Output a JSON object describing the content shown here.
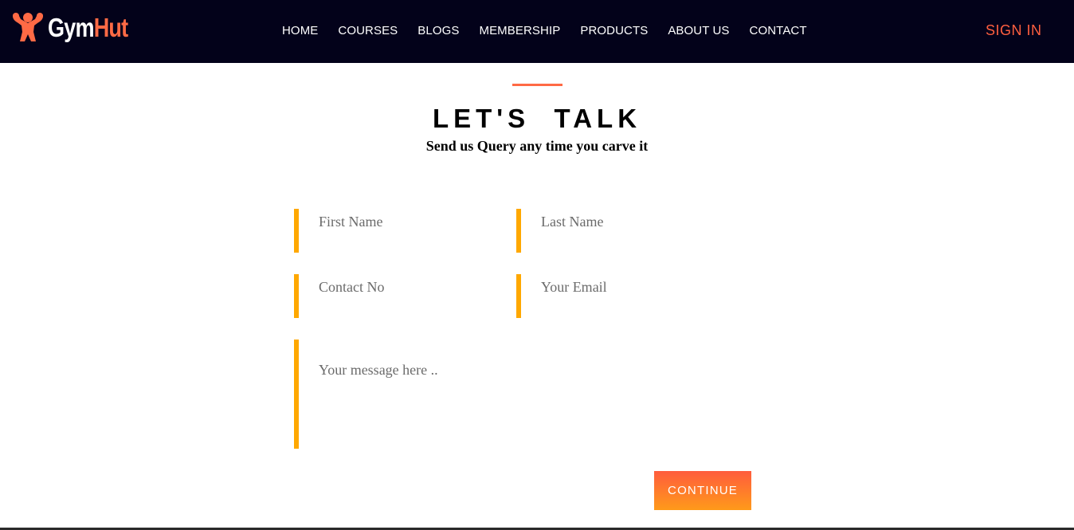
{
  "brand": {
    "part1": "Gym",
    "part2": "Hut",
    "icon": "muscle-man-icon"
  },
  "nav": {
    "items": [
      "HOME",
      "COURSES",
      "BLOGS",
      "MEMBERSHIP",
      "PRODUCTS",
      "ABOUT US",
      "CONTACT"
    ],
    "sign_in": "SIGN IN"
  },
  "section": {
    "title": "LET'S  TALK",
    "subtitle": "Send us Query any time you carve it"
  },
  "form": {
    "first_name": {
      "placeholder": "First Name",
      "value": ""
    },
    "last_name": {
      "placeholder": "Last Name",
      "value": ""
    },
    "contact": {
      "placeholder": "Contact No",
      "value": ""
    },
    "email": {
      "placeholder": "Your Email",
      "value": ""
    },
    "message": {
      "placeholder": "Your message here ..",
      "value": ""
    },
    "submit_label": "CONTINUE"
  },
  "colors": {
    "navbar_bg": "#03021a",
    "accent": "#ff6a45",
    "field_border": "#ffa800"
  }
}
